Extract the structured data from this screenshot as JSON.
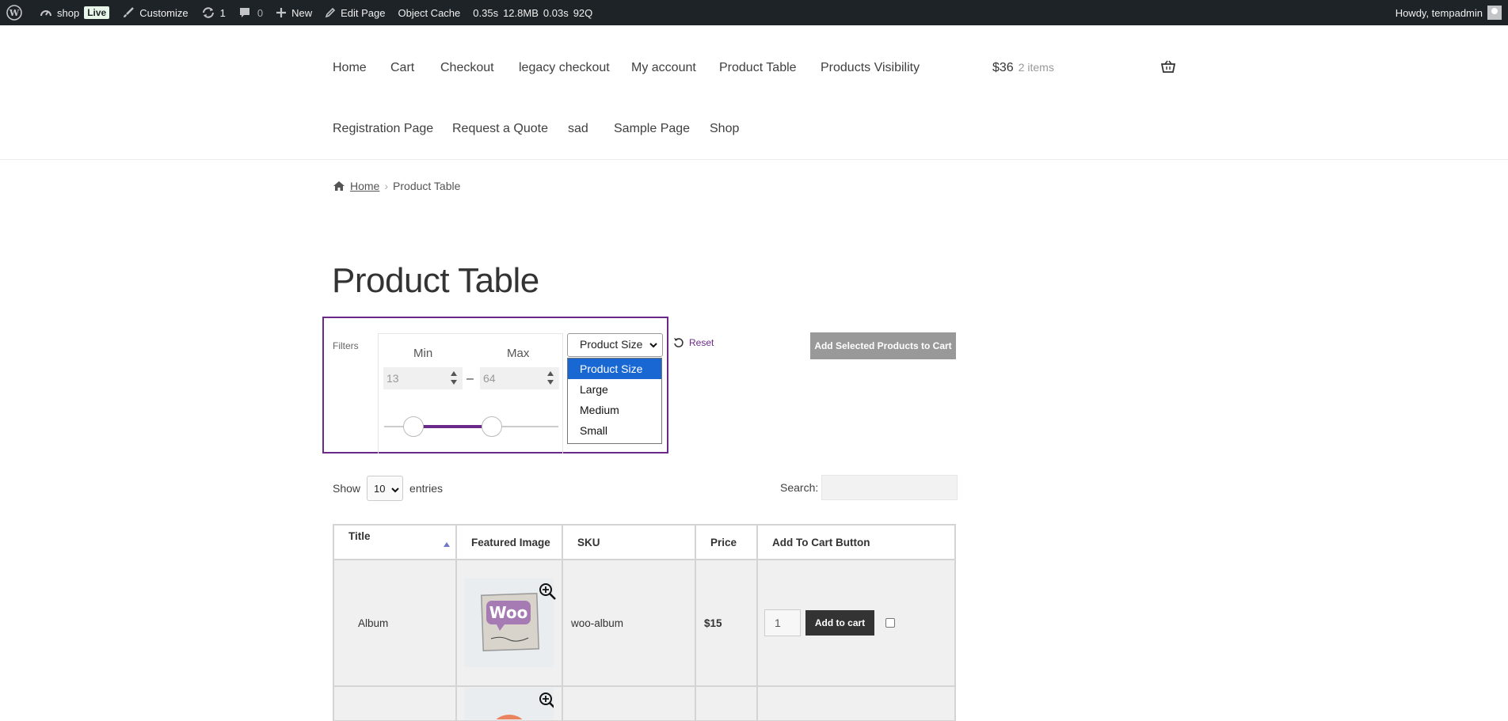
{
  "admin_bar": {
    "site_name": "shop",
    "live_badge": "Live",
    "customize": "Customize",
    "updates_count": "1",
    "comments_count": "0",
    "new_label": "New",
    "edit_page": "Edit Page",
    "object_cache": "Object Cache",
    "stats": [
      "0.35s",
      "12.8MB",
      "0.03s",
      "92Q"
    ],
    "howdy": "Howdy, tempadmin"
  },
  "nav": {
    "row1": [
      "Home",
      "Cart",
      "Checkout",
      "legacy checkout",
      "My account",
      "Product Table",
      "Products Visibility"
    ],
    "row2": [
      "Registration Page",
      "Request a Quote",
      "sad",
      "Sample Page",
      "Shop"
    ]
  },
  "mini_cart": {
    "total": "$36",
    "count": "2 items"
  },
  "breadcrumb": {
    "home": "Home",
    "current": "Product Table"
  },
  "page_title": "Product Table",
  "filters": {
    "label": "Filters",
    "min_label": "Min",
    "max_label": "Max",
    "min_value": "13",
    "max_value": "64",
    "dash": "–",
    "size_select": {
      "selected": "Product Size",
      "options": [
        "Product Size",
        "Large",
        "Medium",
        "Small"
      ]
    },
    "reset": "Reset"
  },
  "add_selected_button": "Add Selected Products to Cart",
  "table_controls": {
    "show": "Show",
    "entries_value": "10",
    "entries": "entries",
    "search_label": "Search:"
  },
  "table": {
    "headers": [
      "Title",
      "Featured Image",
      "SKU",
      "Price",
      "Add To Cart Button"
    ],
    "rows": [
      {
        "title": "Album",
        "sku": "woo-album",
        "price": "$15",
        "qty": "1",
        "button": "Add to cart"
      }
    ]
  },
  "colors": {
    "admin_bar": "#1d2327",
    "accent_purple": "#6b2a8a",
    "select_highlight": "#1967d2",
    "button_dark": "#333333"
  }
}
